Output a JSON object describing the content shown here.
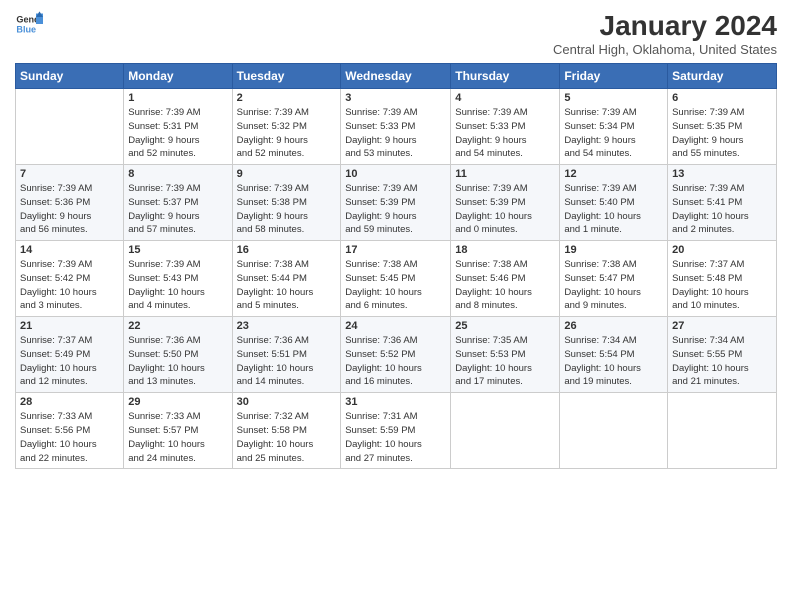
{
  "logo": {
    "line1": "General",
    "line2": "Blue"
  },
  "title": "January 2024",
  "subtitle": "Central High, Oklahoma, United States",
  "days_header": [
    "Sunday",
    "Monday",
    "Tuesday",
    "Wednesday",
    "Thursday",
    "Friday",
    "Saturday"
  ],
  "weeks": [
    [
      {
        "num": "",
        "info": ""
      },
      {
        "num": "1",
        "info": "Sunrise: 7:39 AM\nSunset: 5:31 PM\nDaylight: 9 hours\nand 52 minutes."
      },
      {
        "num": "2",
        "info": "Sunrise: 7:39 AM\nSunset: 5:32 PM\nDaylight: 9 hours\nand 52 minutes."
      },
      {
        "num": "3",
        "info": "Sunrise: 7:39 AM\nSunset: 5:33 PM\nDaylight: 9 hours\nand 53 minutes."
      },
      {
        "num": "4",
        "info": "Sunrise: 7:39 AM\nSunset: 5:33 PM\nDaylight: 9 hours\nand 54 minutes."
      },
      {
        "num": "5",
        "info": "Sunrise: 7:39 AM\nSunset: 5:34 PM\nDaylight: 9 hours\nand 54 minutes."
      },
      {
        "num": "6",
        "info": "Sunrise: 7:39 AM\nSunset: 5:35 PM\nDaylight: 9 hours\nand 55 minutes."
      }
    ],
    [
      {
        "num": "7",
        "info": "Sunrise: 7:39 AM\nSunset: 5:36 PM\nDaylight: 9 hours\nand 56 minutes."
      },
      {
        "num": "8",
        "info": "Sunrise: 7:39 AM\nSunset: 5:37 PM\nDaylight: 9 hours\nand 57 minutes."
      },
      {
        "num": "9",
        "info": "Sunrise: 7:39 AM\nSunset: 5:38 PM\nDaylight: 9 hours\nand 58 minutes."
      },
      {
        "num": "10",
        "info": "Sunrise: 7:39 AM\nSunset: 5:39 PM\nDaylight: 9 hours\nand 59 minutes."
      },
      {
        "num": "11",
        "info": "Sunrise: 7:39 AM\nSunset: 5:39 PM\nDaylight: 10 hours\nand 0 minutes."
      },
      {
        "num": "12",
        "info": "Sunrise: 7:39 AM\nSunset: 5:40 PM\nDaylight: 10 hours\nand 1 minute."
      },
      {
        "num": "13",
        "info": "Sunrise: 7:39 AM\nSunset: 5:41 PM\nDaylight: 10 hours\nand 2 minutes."
      }
    ],
    [
      {
        "num": "14",
        "info": "Sunrise: 7:39 AM\nSunset: 5:42 PM\nDaylight: 10 hours\nand 3 minutes."
      },
      {
        "num": "15",
        "info": "Sunrise: 7:39 AM\nSunset: 5:43 PM\nDaylight: 10 hours\nand 4 minutes."
      },
      {
        "num": "16",
        "info": "Sunrise: 7:38 AM\nSunset: 5:44 PM\nDaylight: 10 hours\nand 5 minutes."
      },
      {
        "num": "17",
        "info": "Sunrise: 7:38 AM\nSunset: 5:45 PM\nDaylight: 10 hours\nand 6 minutes."
      },
      {
        "num": "18",
        "info": "Sunrise: 7:38 AM\nSunset: 5:46 PM\nDaylight: 10 hours\nand 8 minutes."
      },
      {
        "num": "19",
        "info": "Sunrise: 7:38 AM\nSunset: 5:47 PM\nDaylight: 10 hours\nand 9 minutes."
      },
      {
        "num": "20",
        "info": "Sunrise: 7:37 AM\nSunset: 5:48 PM\nDaylight: 10 hours\nand 10 minutes."
      }
    ],
    [
      {
        "num": "21",
        "info": "Sunrise: 7:37 AM\nSunset: 5:49 PM\nDaylight: 10 hours\nand 12 minutes."
      },
      {
        "num": "22",
        "info": "Sunrise: 7:36 AM\nSunset: 5:50 PM\nDaylight: 10 hours\nand 13 minutes."
      },
      {
        "num": "23",
        "info": "Sunrise: 7:36 AM\nSunset: 5:51 PM\nDaylight: 10 hours\nand 14 minutes."
      },
      {
        "num": "24",
        "info": "Sunrise: 7:36 AM\nSunset: 5:52 PM\nDaylight: 10 hours\nand 16 minutes."
      },
      {
        "num": "25",
        "info": "Sunrise: 7:35 AM\nSunset: 5:53 PM\nDaylight: 10 hours\nand 17 minutes."
      },
      {
        "num": "26",
        "info": "Sunrise: 7:34 AM\nSunset: 5:54 PM\nDaylight: 10 hours\nand 19 minutes."
      },
      {
        "num": "27",
        "info": "Sunrise: 7:34 AM\nSunset: 5:55 PM\nDaylight: 10 hours\nand 21 minutes."
      }
    ],
    [
      {
        "num": "28",
        "info": "Sunrise: 7:33 AM\nSunset: 5:56 PM\nDaylight: 10 hours\nand 22 minutes."
      },
      {
        "num": "29",
        "info": "Sunrise: 7:33 AM\nSunset: 5:57 PM\nDaylight: 10 hours\nand 24 minutes."
      },
      {
        "num": "30",
        "info": "Sunrise: 7:32 AM\nSunset: 5:58 PM\nDaylight: 10 hours\nand 25 minutes."
      },
      {
        "num": "31",
        "info": "Sunrise: 7:31 AM\nSunset: 5:59 PM\nDaylight: 10 hours\nand 27 minutes."
      },
      {
        "num": "",
        "info": ""
      },
      {
        "num": "",
        "info": ""
      },
      {
        "num": "",
        "info": ""
      }
    ]
  ]
}
